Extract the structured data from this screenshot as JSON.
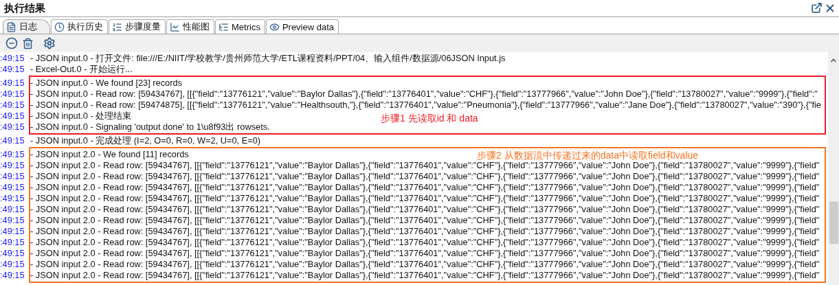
{
  "panel": {
    "title": "执行结果"
  },
  "tabs": [
    {
      "label": "日志",
      "selected": true
    },
    {
      "label": "执行历史",
      "selected": false
    },
    {
      "label": "步骤度量",
      "selected": false
    },
    {
      "label": "性能图",
      "selected": false
    },
    {
      "label": "Metrics",
      "selected": false
    },
    {
      "label": "Preview data",
      "selected": false
    }
  ],
  "log_groups": [
    {
      "lines": [
        {
          "time": ":49:15",
          "text": "- JSON input.0 - 打开文件: file:///E:/NIIT/学校教学/贵州师范大学/ETL课程资料/PPT/04、输入组件/数据源/06JSON Input.js"
        },
        {
          "time": ":49:15",
          "text": "- Excel-Out.0 - 开始运行..."
        }
      ]
    },
    {
      "frame": {
        "color": "#ee1c25",
        "label": "步骤1 先读取id 和 data"
      },
      "lines": [
        {
          "time": ":49:15",
          "text": "- JSON input.0 - We found [23] records"
        },
        {
          "time": ":49:15",
          "text": "- JSON input.0 - Read row: [59434767], [[{\"field\":\"13776121\",\"value\":\"Baylor Dallas\"},{\"field\":\"13776401\",\"value\":\"CHF\"},{\"field\":\"13777966\",\"value\":\"John Doe\"},{\"field\":\"13780027\",\"value\":\"9999\"},{\"field\":\""
        },
        {
          "time": ":49:15",
          "text": "- JSON input.0 - Read row: [59474875], [[{\"field\":\"13776121\",\"value\":\"Healthsouth,\"},{\"field\":\"13776401\",\"value\":\"Pneumonia\"},{\"field\":\"13777966\",\"value\":\"Jane Doe\"},{\"field\":\"13780027\",\"value\":\"390\"},{\"fie"
        },
        {
          "time": ":49:15",
          "text": "- JSON input.0 - 处理结束"
        },
        {
          "time": ":49:15",
          "text": "- JSON input.0 - Signaling 'output done' to 1\\u8f93出 rowsets."
        }
      ]
    },
    {
      "lines": [
        {
          "time": ":49:15",
          "text": "- JSON input.0 - 完成处理 (I=2, O=0, R=0, W=2, U=0, E=0)"
        }
      ]
    },
    {
      "frame": {
        "color": "#f47320",
        "label": "步骤2 从数据流中传递过来的data中读取field和value"
      },
      "lines": [
        {
          "time": ":49:15",
          "text": "- JSON input 2.0 - We found [11] records"
        },
        {
          "time": ":49:15",
          "text": "- JSON input 2.0 - Read row: [59434767], [[{\"field\":\"13776121\",\"value\":\"Baylor Dallas\"},{\"field\":\"13776401\",\"value\":\"CHF\"},{\"field\":\"13777966\",\"value\":\"John Doe\"},{\"field\":\"13780027\",\"value\":\"9999\"},{\"field\""
        },
        {
          "time": ":49:15",
          "text": "- JSON input 2.0 - Read row: [59434767], [[{\"field\":\"13776121\",\"value\":\"Baylor Dallas\"},{\"field\":\"13776401\",\"value\":\"CHF\"},{\"field\":\"13777966\",\"value\":\"John Doe\"},{\"field\":\"13780027\",\"value\":\"9999\"},{\"field\""
        },
        {
          "time": ":49:15",
          "text": "- JSON input 2.0 - Read row: [59434767], [[{\"field\":\"13776121\",\"value\":\"Baylor Dallas\"},{\"field\":\"13776401\",\"value\":\"CHF\"},{\"field\":\"13777966\",\"value\":\"John Doe\"},{\"field\":\"13780027\",\"value\":\"9999\"},{\"field\""
        },
        {
          "time": ":49:15",
          "text": "- JSON input 2.0 - Read row: [59434767], [[{\"field\":\"13776121\",\"value\":\"Baylor Dallas\"},{\"field\":\"13776401\",\"value\":\"CHF\"},{\"field\":\"13777966\",\"value\":\"John Doe\"},{\"field\":\"13780027\",\"value\":\"9999\"},{\"field\""
        },
        {
          "time": ":49:15",
          "text": "- JSON input 2.0 - Read row: [59434767], [[{\"field\":\"13776121\",\"value\":\"Baylor Dallas\"},{\"field\":\"13776401\",\"value\":\"CHF\"},{\"field\":\"13777966\",\"value\":\"John Doe\"},{\"field\":\"13780027\",\"value\":\"9999\"},{\"field\""
        },
        {
          "time": ":49:15",
          "text": "- JSON input 2.0 - Read row: [59434767], [[{\"field\":\"13776121\",\"value\":\"Baylor Dallas\"},{\"field\":\"13776401\",\"value\":\"CHF\"},{\"field\":\"13777966\",\"value\":\"John Doe\"},{\"field\":\"13780027\",\"value\":\"9999\"},{\"field\""
        },
        {
          "time": ":49:15",
          "text": "- JSON input 2.0 - Read row: [59434767], [[{\"field\":\"13776121\",\"value\":\"Baylor Dallas\"},{\"field\":\"13776401\",\"value\":\"CHF\"},{\"field\":\"13777966\",\"value\":\"John Doe\"},{\"field\":\"13780027\",\"value\":\"9999\"},{\"field\""
        },
        {
          "time": ":49:15",
          "text": "- JSON input 2.0 - Read row: [59434767], [[{\"field\":\"13776121\",\"value\":\"Baylor Dallas\"},{\"field\":\"13776401\",\"value\":\"CHF\"},{\"field\":\"13777966\",\"value\":\"John Doe\"},{\"field\":\"13780027\",\"value\":\"9999\"},{\"field\""
        },
        {
          "time": ":49:15",
          "text": "- JSON input 2.0 - Read row: [59434767], [[{\"field\":\"13776121\",\"value\":\"Baylor Dallas\"},{\"field\":\"13776401\",\"value\":\"CHF\"},{\"field\":\"13777966\",\"value\":\"John Doe\"},{\"field\":\"13780027\",\"value\":\"9999\"},{\"field\""
        },
        {
          "time": ":49:15",
          "text": "- JSON input 2.0 - Read row: [59434767], [[{\"field\":\"13776121\",\"value\":\"Baylor Dallas\"},{\"field\":\"13776401\",\"value\":\"CHF\"},{\"field\":\"13777966\",\"value\":\"John Doe\"},{\"field\":\"13780027\",\"value\":\"9999\"},{\"field\""
        },
        {
          "time": ":49:15",
          "text": "- JSON input 2.0 - Read row: [59434767], [[{\"field\":\"13776121\",\"value\":\"Baylor Dallas\"},{\"field\":\"13776401\",\"value\":\"CHF\"},{\"field\":\"13777966\",\"value\":\"John Doe\"},{\"field\":\"13780027\",\"value\":\"9999\"},{\"field\""
        }
      ]
    }
  ]
}
